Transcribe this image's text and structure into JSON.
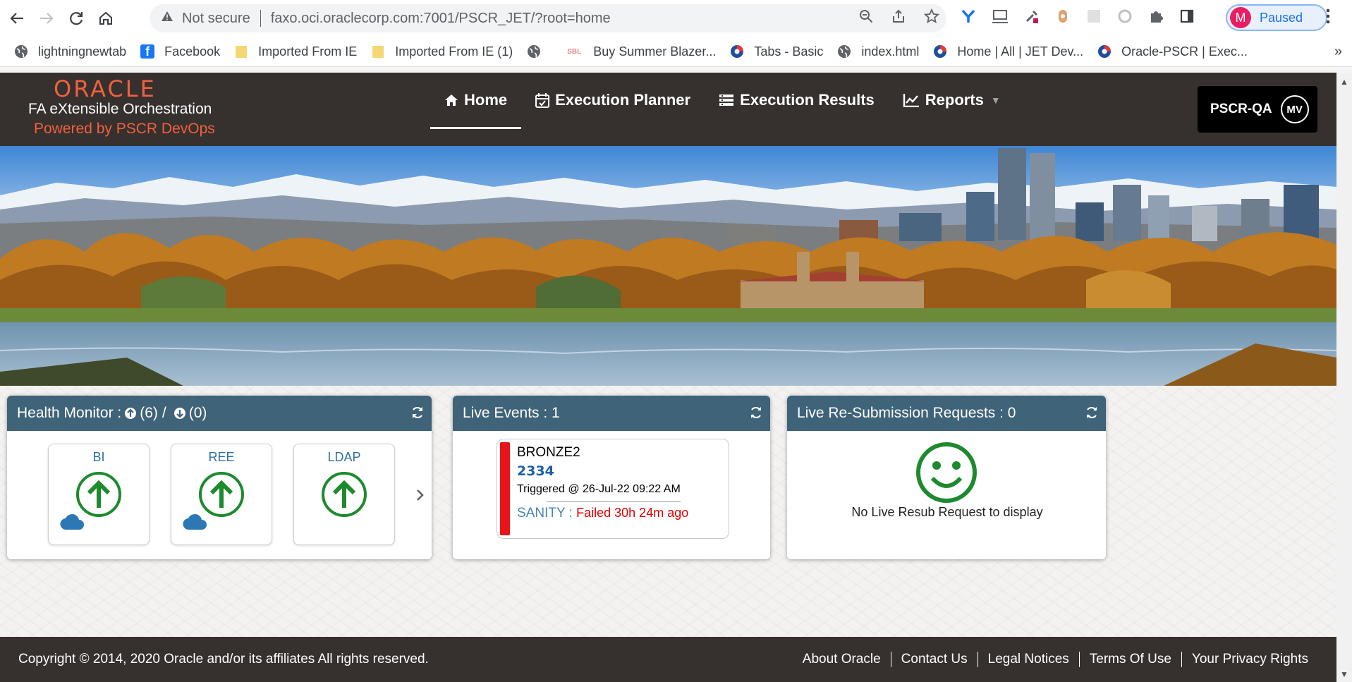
{
  "browser": {
    "security_label": "Not secure",
    "url": "faxo.oci.oraclecorp.com:7001/PSCR_JET/?root=home",
    "profile_initial": "M",
    "profile_status": "Paused",
    "bookmarks": [
      {
        "label": "lightningnewtab",
        "icon": "globe-icon"
      },
      {
        "label": "Facebook",
        "icon": "facebook-icon"
      },
      {
        "label": "Imported From IE",
        "icon": "folder-icon"
      },
      {
        "label": "Imported From IE (1)",
        "icon": "folder-icon"
      },
      {
        "label": "",
        "icon": "globe-icon"
      },
      {
        "label": "Buy Summer Blazer...",
        "icon": "sbl-icon",
        "icon_text": "SBL"
      },
      {
        "label": "Tabs - Basic",
        "icon": "jet-icon"
      },
      {
        "label": "index.html",
        "icon": "globe-icon"
      },
      {
        "label": "Home | All | JET Dev...",
        "icon": "jet-icon"
      },
      {
        "label": "Oracle-PSCR | Exec...",
        "icon": "jet-icon"
      }
    ]
  },
  "header": {
    "logo": "ORACLE",
    "app_title": "FA eXtensible Orchestration",
    "powered_by": "Powered by PSCR DevOps",
    "nav": [
      {
        "label": "Home",
        "icon": "home-icon",
        "active": true
      },
      {
        "label": "Execution Planner",
        "icon": "calendar-check-icon"
      },
      {
        "label": "Execution Results",
        "icon": "list-icon"
      },
      {
        "label": "Reports",
        "icon": "line-chart-icon",
        "dropdown": true
      }
    ],
    "environment": "PSCR-QA",
    "user_initials": "MV"
  },
  "health_monitor": {
    "title": "Health Monitor :",
    "up_count": "(6)",
    "separator": "/",
    "down_count": "(0)",
    "tiles": [
      {
        "label": "BI",
        "status": "up",
        "cloud": true
      },
      {
        "label": "REE",
        "status": "up",
        "cloud": true
      },
      {
        "label": "LDAP",
        "status": "up",
        "cloud": false
      }
    ]
  },
  "live_events": {
    "title": "Live Events : 1",
    "event": {
      "name": "BRONZE2",
      "id": "2334",
      "triggered": "Triggered @ 26-Jul-22 09:22 AM",
      "type": "SANITY :",
      "status": "Failed 30h 24m ago",
      "status_color": "#e00000"
    }
  },
  "resubmission": {
    "title": "Live Re-Submission Requests : 0",
    "empty_message": "No Live Resub Request to display"
  },
  "footer": {
    "copyright": "Copyright © 2014, 2020 Oracle and/or its affiliates All rights reserved.",
    "links": [
      "About Oracle",
      "Contact Us",
      "Legal Notices",
      "Terms Of Use",
      "Your Privacy Rights"
    ]
  },
  "colors": {
    "header_bg": "#36302e",
    "oracle_red": "#f0613f",
    "card_header": "#3f6378",
    "status_up": "#1e8a2e",
    "event_bar": "#e8141a",
    "cloud": "#2b78b5"
  }
}
